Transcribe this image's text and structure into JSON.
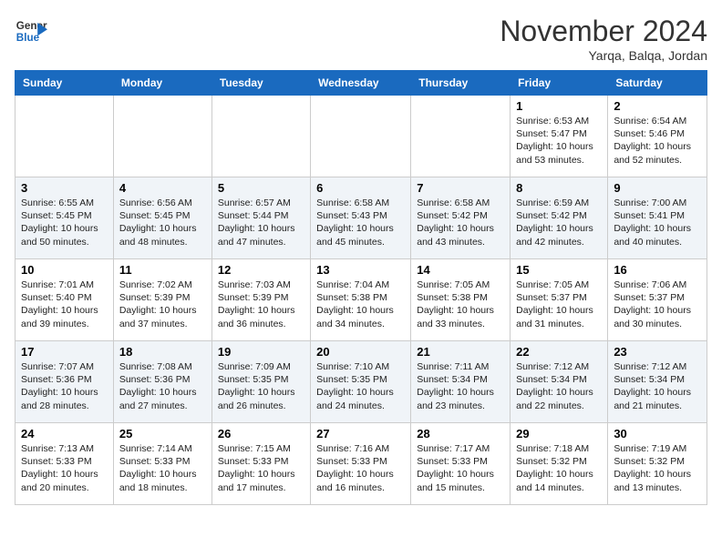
{
  "logo": {
    "line1": "General",
    "line2": "Blue"
  },
  "title": "November 2024",
  "subtitle": "Yarqa, Balqa, Jordan",
  "days_of_week": [
    "Sunday",
    "Monday",
    "Tuesday",
    "Wednesday",
    "Thursday",
    "Friday",
    "Saturday"
  ],
  "weeks": [
    [
      {
        "day": "",
        "info": ""
      },
      {
        "day": "",
        "info": ""
      },
      {
        "day": "",
        "info": ""
      },
      {
        "day": "",
        "info": ""
      },
      {
        "day": "",
        "info": ""
      },
      {
        "day": "1",
        "info": "Sunrise: 6:53 AM\nSunset: 5:47 PM\nDaylight: 10 hours\nand 53 minutes."
      },
      {
        "day": "2",
        "info": "Sunrise: 6:54 AM\nSunset: 5:46 PM\nDaylight: 10 hours\nand 52 minutes."
      }
    ],
    [
      {
        "day": "3",
        "info": "Sunrise: 6:55 AM\nSunset: 5:45 PM\nDaylight: 10 hours\nand 50 minutes."
      },
      {
        "day": "4",
        "info": "Sunrise: 6:56 AM\nSunset: 5:45 PM\nDaylight: 10 hours\nand 48 minutes."
      },
      {
        "day": "5",
        "info": "Sunrise: 6:57 AM\nSunset: 5:44 PM\nDaylight: 10 hours\nand 47 minutes."
      },
      {
        "day": "6",
        "info": "Sunrise: 6:58 AM\nSunset: 5:43 PM\nDaylight: 10 hours\nand 45 minutes."
      },
      {
        "day": "7",
        "info": "Sunrise: 6:58 AM\nSunset: 5:42 PM\nDaylight: 10 hours\nand 43 minutes."
      },
      {
        "day": "8",
        "info": "Sunrise: 6:59 AM\nSunset: 5:42 PM\nDaylight: 10 hours\nand 42 minutes."
      },
      {
        "day": "9",
        "info": "Sunrise: 7:00 AM\nSunset: 5:41 PM\nDaylight: 10 hours\nand 40 minutes."
      }
    ],
    [
      {
        "day": "10",
        "info": "Sunrise: 7:01 AM\nSunset: 5:40 PM\nDaylight: 10 hours\nand 39 minutes."
      },
      {
        "day": "11",
        "info": "Sunrise: 7:02 AM\nSunset: 5:39 PM\nDaylight: 10 hours\nand 37 minutes."
      },
      {
        "day": "12",
        "info": "Sunrise: 7:03 AM\nSunset: 5:39 PM\nDaylight: 10 hours\nand 36 minutes."
      },
      {
        "day": "13",
        "info": "Sunrise: 7:04 AM\nSunset: 5:38 PM\nDaylight: 10 hours\nand 34 minutes."
      },
      {
        "day": "14",
        "info": "Sunrise: 7:05 AM\nSunset: 5:38 PM\nDaylight: 10 hours\nand 33 minutes."
      },
      {
        "day": "15",
        "info": "Sunrise: 7:05 AM\nSunset: 5:37 PM\nDaylight: 10 hours\nand 31 minutes."
      },
      {
        "day": "16",
        "info": "Sunrise: 7:06 AM\nSunset: 5:37 PM\nDaylight: 10 hours\nand 30 minutes."
      }
    ],
    [
      {
        "day": "17",
        "info": "Sunrise: 7:07 AM\nSunset: 5:36 PM\nDaylight: 10 hours\nand 28 minutes."
      },
      {
        "day": "18",
        "info": "Sunrise: 7:08 AM\nSunset: 5:36 PM\nDaylight: 10 hours\nand 27 minutes."
      },
      {
        "day": "19",
        "info": "Sunrise: 7:09 AM\nSunset: 5:35 PM\nDaylight: 10 hours\nand 26 minutes."
      },
      {
        "day": "20",
        "info": "Sunrise: 7:10 AM\nSunset: 5:35 PM\nDaylight: 10 hours\nand 24 minutes."
      },
      {
        "day": "21",
        "info": "Sunrise: 7:11 AM\nSunset: 5:34 PM\nDaylight: 10 hours\nand 23 minutes."
      },
      {
        "day": "22",
        "info": "Sunrise: 7:12 AM\nSunset: 5:34 PM\nDaylight: 10 hours\nand 22 minutes."
      },
      {
        "day": "23",
        "info": "Sunrise: 7:12 AM\nSunset: 5:34 PM\nDaylight: 10 hours\nand 21 minutes."
      }
    ],
    [
      {
        "day": "24",
        "info": "Sunrise: 7:13 AM\nSunset: 5:33 PM\nDaylight: 10 hours\nand 20 minutes."
      },
      {
        "day": "25",
        "info": "Sunrise: 7:14 AM\nSunset: 5:33 PM\nDaylight: 10 hours\nand 18 minutes."
      },
      {
        "day": "26",
        "info": "Sunrise: 7:15 AM\nSunset: 5:33 PM\nDaylight: 10 hours\nand 17 minutes."
      },
      {
        "day": "27",
        "info": "Sunrise: 7:16 AM\nSunset: 5:33 PM\nDaylight: 10 hours\nand 16 minutes."
      },
      {
        "day": "28",
        "info": "Sunrise: 7:17 AM\nSunset: 5:33 PM\nDaylight: 10 hours\nand 15 minutes."
      },
      {
        "day": "29",
        "info": "Sunrise: 7:18 AM\nSunset: 5:32 PM\nDaylight: 10 hours\nand 14 minutes."
      },
      {
        "day": "30",
        "info": "Sunrise: 7:19 AM\nSunset: 5:32 PM\nDaylight: 10 hours\nand 13 minutes."
      }
    ]
  ]
}
